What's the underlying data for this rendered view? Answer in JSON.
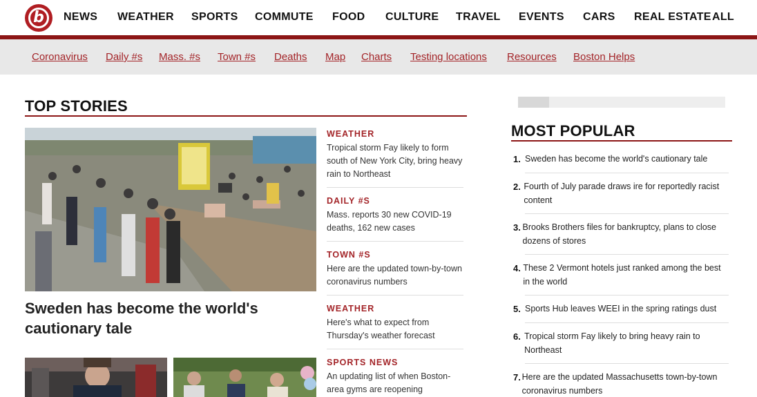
{
  "nav": {
    "items": [
      "NEWS",
      "WEATHER",
      "SPORTS",
      "COMMUTE",
      "FOOD",
      "CULTURE",
      "TRAVEL",
      "EVENTS",
      "CARS",
      "REAL ESTATE",
      "ALL"
    ],
    "logo_letter": "b",
    "brand_color": "#b01d22"
  },
  "subnav": {
    "items": [
      "Coronavirus",
      "Daily #s",
      "Mass. #s",
      "Town #s",
      "Deaths",
      "Map",
      "Charts",
      "Testing locations",
      "Resources",
      "Boston Helps"
    ]
  },
  "top_stories": {
    "title": "TOP STORIES",
    "hero_headline": "Sweden has become the world's cautionary tale",
    "side": [
      {
        "category": "WEATHER",
        "text": "Tropical storm Fay likely to form south of New York City, bring heavy rain to Northeast"
      },
      {
        "category": "DAILY #S",
        "text": "Mass. reports 30 new COVID-19 deaths, 162 new cases"
      },
      {
        "category": "TOWN #S",
        "text": "Here are the updated town-by-town coronavirus numbers"
      },
      {
        "category": "WEATHER",
        "text": "Here's what to expect from Thursday's weather forecast"
      },
      {
        "category": "SPORTS NEWS",
        "text": "An updating list of when Boston-area gyms are reopening"
      }
    ]
  },
  "most_popular": {
    "title": "MOST POPULAR",
    "items": [
      {
        "num": "1.",
        "text": "Sweden has become the world's cautionary tale"
      },
      {
        "num": "2.",
        "text": "Fourth of July parade draws ire for reportedly racist content"
      },
      {
        "num": "3.",
        "text": "Brooks Brothers files for bankruptcy, plans to close dozens of stores"
      },
      {
        "num": "4.",
        "text": "These 2 Vermont hotels just ranked among the best in the world"
      },
      {
        "num": "5.",
        "text": "Sports Hub leaves WEEI in the spring ratings dust"
      },
      {
        "num": "6.",
        "text": "Tropical storm Fay likely to bring heavy rain to Northeast"
      },
      {
        "num": "7.",
        "text": "Here are the updated Massachusetts town-by-town coronavirus numbers"
      }
    ]
  }
}
